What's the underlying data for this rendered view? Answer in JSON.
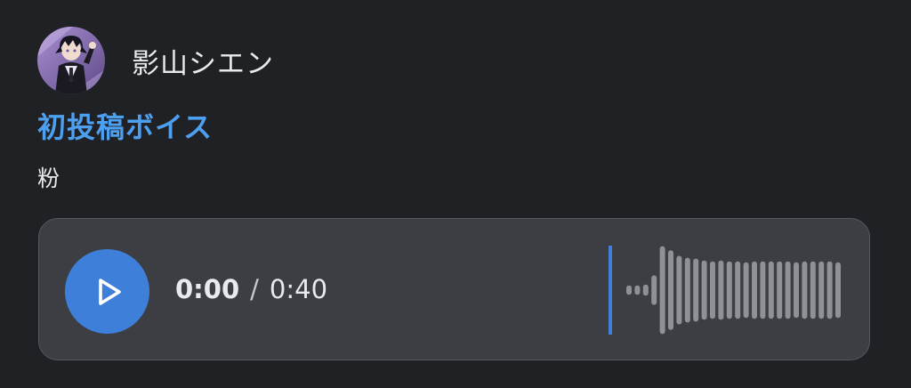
{
  "author": {
    "name": "影山シエン",
    "avatar_icon": "user-avatar"
  },
  "post": {
    "title": "初投稿ボイス",
    "body": "粉"
  },
  "player": {
    "current_time": "0:00",
    "separator": "/",
    "duration": "0:40",
    "play_icon": "play-icon",
    "progress": 0,
    "waveform_levels": [
      0.1,
      0.1,
      0.12,
      0.32,
      0.95,
      0.86,
      0.74,
      0.7,
      0.68,
      0.64,
      0.62,
      0.64,
      0.62,
      0.62,
      0.6,
      0.62,
      0.62,
      0.62,
      0.62,
      0.62,
      0.6,
      0.62,
      0.62,
      0.62,
      0.62,
      0.6
    ],
    "accent_color": "#3d7fd9",
    "bar_color": "#8f9196"
  },
  "colors": {
    "background": "#202124",
    "card": "#3c3e43",
    "title_link": "#4d9ff0"
  }
}
